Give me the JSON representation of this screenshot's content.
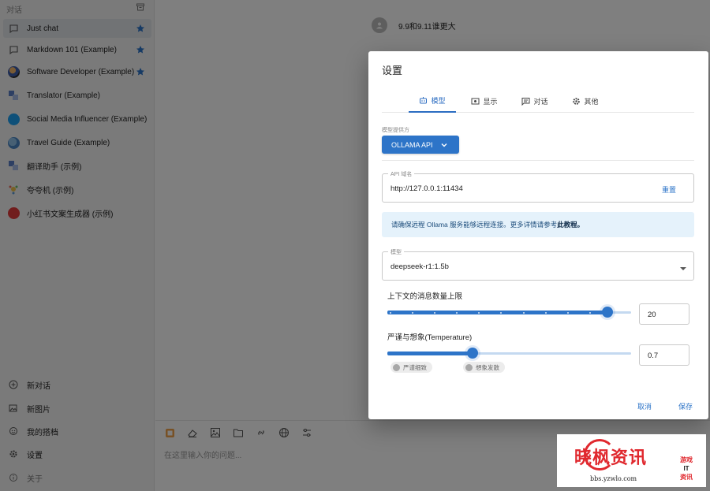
{
  "sidebar": {
    "header": "对话",
    "items": [
      {
        "label": "Just chat",
        "starred": true,
        "active": true
      },
      {
        "label": "Markdown 101 (Example)",
        "starred": true
      },
      {
        "label": "Software Developer (Example)",
        "starred": true
      },
      {
        "label": "Translator (Example)"
      },
      {
        "label": "Social Media Influencer (Example)"
      },
      {
        "label": "Travel Guide (Example)"
      },
      {
        "label": "翻译助手 (示例)"
      },
      {
        "label": "夸夸机 (示例)"
      },
      {
        "label": "小红书文案生成器 (示例)"
      }
    ],
    "bottom": {
      "new_chat": "新对话",
      "new_image": "新图片",
      "my_partners": "我的搭档",
      "settings": "设置",
      "about": "关于"
    }
  },
  "chat": {
    "message": "9.9和9.11谁更大",
    "input_placeholder": "在这里输入你的问题..."
  },
  "dialog": {
    "title": "设置",
    "tabs": [
      {
        "label": "模型",
        "active": true
      },
      {
        "label": "显示"
      },
      {
        "label": "对话"
      },
      {
        "label": "其他"
      }
    ],
    "provider_caption": "模型提供方",
    "provider_value": "OLLAMA API",
    "api_host_label": "API 域名",
    "api_host_value": "http://127.0.0.1:11434",
    "reset_label": "重置",
    "info_text": "请确保远程 Ollama 服务能够远程连接。更多详情请参考",
    "info_link": "此教程。",
    "model_label": "模型",
    "model_value": "deepseek-r1:1.5b",
    "context_label": "上下文的消息数量上限",
    "context_value": "20",
    "context_fraction": 0.904,
    "temperature_label": "严谨与想象(Temperature)",
    "temperature_value": "0.7",
    "temperature_fraction": 0.35,
    "chip_strict": "严谨细致",
    "chip_imaginative": "想象发散",
    "cancel_label": "取消",
    "save_label": "保存"
  },
  "watermark": {
    "brand": "晓枫资讯",
    "url": "bbs.yzwlo.com",
    "side_line1": "游戏",
    "side_line2": "IT",
    "side_line3": "资讯"
  },
  "colors": {
    "accent": "#2d74c8",
    "info_bg": "#e5f2fb",
    "watermark_red": "#e0282e"
  }
}
